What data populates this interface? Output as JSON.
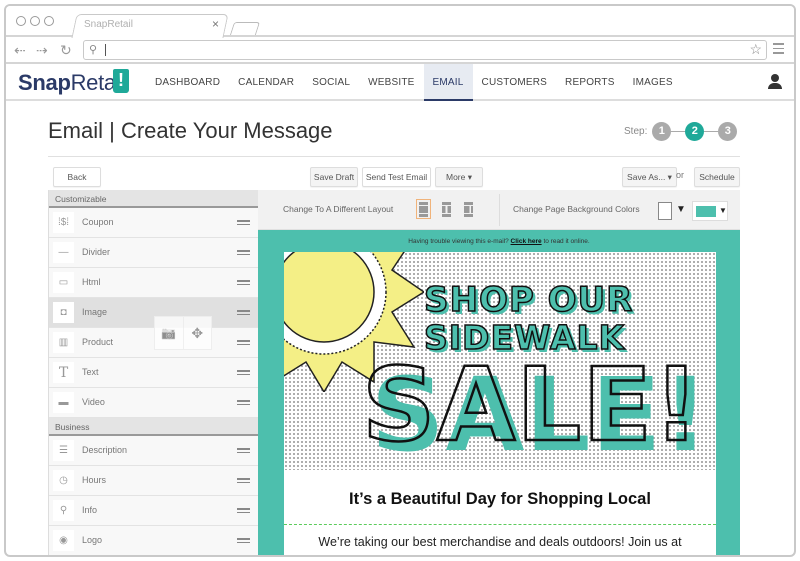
{
  "browser": {
    "tab_title": "SnapRetail",
    "tab_close_icon": "×",
    "url_value": "",
    "back_icon": "⇠",
    "forward_icon": "⇢",
    "reload_icon": "↻",
    "search_icon": "⚲",
    "star_icon": "☆"
  },
  "app": {
    "logo_bold": "Snap",
    "logo_light": "Retail",
    "logo_badge": "!",
    "nav": [
      {
        "label": "DASHBOARD",
        "active": false
      },
      {
        "label": "CALENDAR",
        "active": false
      },
      {
        "label": "SOCIAL",
        "active": false
      },
      {
        "label": "WEBSITE",
        "active": false
      },
      {
        "label": "EMAIL",
        "active": true
      },
      {
        "label": "CUSTOMERS",
        "active": false
      },
      {
        "label": "REPORTS",
        "active": false
      },
      {
        "label": "IMAGES",
        "active": false
      }
    ]
  },
  "page": {
    "title": "Email | Create Your Message",
    "step_label": "Step:",
    "steps": [
      "1",
      "2",
      "3"
    ],
    "current_step": 2
  },
  "actions": {
    "back": "Back",
    "save_draft": "Save Draft",
    "send_test": "Send Test Email",
    "more": "More ▾",
    "save_as": "Save As... ▾",
    "or": "or",
    "schedule": "Schedule"
  },
  "sidebar": {
    "sections": [
      {
        "title": "Customizable",
        "items": [
          {
            "label": "Coupon",
            "icon": "⁞$⁞"
          },
          {
            "label": "Divider",
            "icon": "—"
          },
          {
            "label": "Html",
            "icon": "▭"
          },
          {
            "label": "Image",
            "icon": "◘"
          },
          {
            "label": "Product",
            "icon": "▥"
          },
          {
            "label": "Text",
            "icon": "T"
          },
          {
            "label": "Video",
            "icon": "▬"
          }
        ]
      },
      {
        "title": "Business",
        "items": [
          {
            "label": "Description",
            "icon": "☰"
          },
          {
            "label": "Hours",
            "icon": "◷"
          },
          {
            "label": "Info",
            "icon": "⚲"
          },
          {
            "label": "Logo",
            "icon": "◉"
          }
        ]
      }
    ],
    "hover_tools": {
      "add_image_icon": "📷",
      "move_icon": "✥"
    }
  },
  "editor": {
    "layout_label": "Change To A Different Layout",
    "bg_label": "Change Page Background Colors",
    "colors": {
      "page_bg": "#ffffff",
      "email_bg": "#4dbfad"
    },
    "trouble_text": "Having trouble viewing this e-mail?",
    "trouble_link": "Click here",
    "trouble_suffix": "to read it online."
  },
  "email": {
    "headline_1": "SHOP OUR",
    "headline_2": "SIDEWALK",
    "headline_3": "SALE!",
    "subhead": "It’s a Beautiful Day for Shopping Local",
    "body": "We’re taking our best merchandise and deals outdoors! Join us at"
  }
}
